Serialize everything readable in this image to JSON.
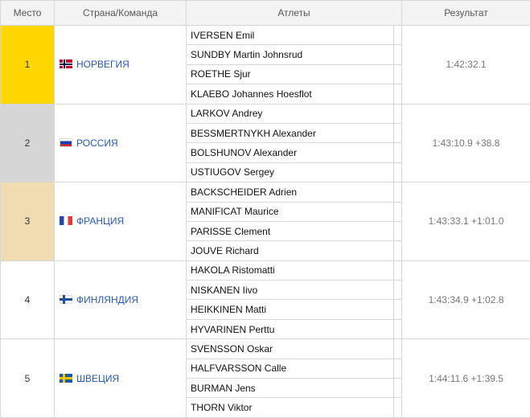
{
  "header": {
    "place": "Место",
    "country": "Страна/Команда",
    "athletes": "Атлеты",
    "result": "Результат"
  },
  "teams": [
    {
      "place": "1",
      "country": "НОРВЕГИЯ",
      "flag": "norway-flag",
      "medal_color": "#ffd600",
      "athletes": [
        "IVERSEN Emil",
        "SUNDBY Martin Johnsrud",
        "ROETHE Sjur",
        "KLAEBO Johannes Hoesflot"
      ],
      "result": "1:42:32.1"
    },
    {
      "place": "2",
      "country": "РОССИЯ",
      "flag": "russia-flag",
      "medal_color": "#d6d6d6",
      "athletes": [
        "LARKOV Andrey",
        "BESSMERTNYKH Alexander",
        "BOLSHUNOV Alexander",
        "USTIUGOV Sergey"
      ],
      "result": "1:43:10.9 +38.8"
    },
    {
      "place": "3",
      "country": "ФРАНЦИЯ",
      "flag": "france-flag",
      "medal_color": "#efdcb0",
      "athletes": [
        "BACKSCHEIDER Adrien",
        "MANIFICAT Maurice",
        "PARISSE Clement",
        "JOUVE Richard"
      ],
      "result": "1:43:33.1 +1:01.0"
    },
    {
      "place": "4",
      "country": "ФИНЛЯНДИЯ",
      "flag": "finland-flag",
      "athletes": [
        "HAKOLA Ristomatti",
        "NISKANEN Iivo",
        "HEIKKINEN Matti",
        "HYVARINEN Perttu"
      ],
      "result": "1:43:34.9 +1:02.8"
    },
    {
      "place": "5",
      "country": "ШВЕЦИЯ",
      "flag": "sweden-flag",
      "athletes": [
        "SVENSSON Oskar",
        "HALFVARSSON Calle",
        "BURMAN Jens",
        "THORN Viktor"
      ],
      "result": "1:44:11.6 +1:39.5"
    }
  ]
}
